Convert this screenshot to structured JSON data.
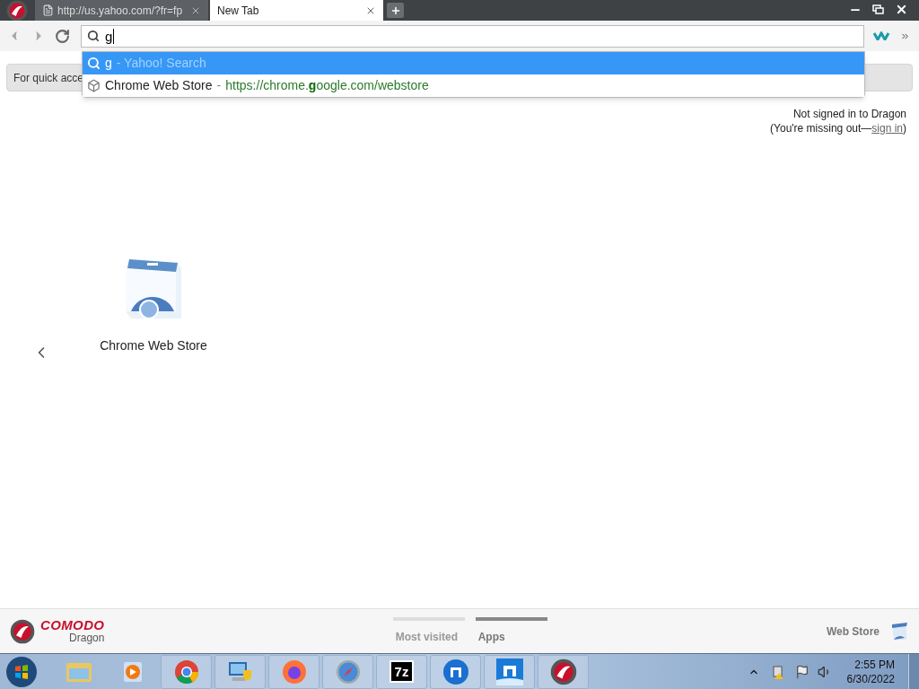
{
  "tabs": [
    {
      "title": "http://us.yahoo.com/?fr=fp",
      "selected": false
    },
    {
      "title": "New Tab",
      "selected": true
    }
  ],
  "omnibox": {
    "value": "g"
  },
  "suggestions": [
    {
      "kind": "search",
      "query": "g",
      "description": "- Yahoo! Search",
      "selected": true
    },
    {
      "kind": "url",
      "title": "Chrome Web Store",
      "separator": "-",
      "url": "https://chrome.**g**oogle.com/webstore",
      "selected": false
    }
  ],
  "bookmark_hint": "For quick acce",
  "signin": {
    "line1": "Not signed in to Dragon",
    "prefix": "(You're missing out—",
    "link": "sign in",
    "suffix": ")"
  },
  "apps": [
    {
      "name": "Chrome Web Store"
    }
  ],
  "footer": {
    "brand": "COMODO",
    "product": "Dragon",
    "tabs": [
      {
        "label": "Most visited",
        "selected": false
      },
      {
        "label": "Apps",
        "selected": true
      }
    ],
    "web_store": "Web Store"
  },
  "taskbar": {
    "items": [
      {
        "kind": "explorer",
        "running": false
      },
      {
        "kind": "media",
        "running": false
      },
      {
        "kind": "chrome",
        "running": true
      },
      {
        "kind": "control",
        "running": true
      },
      {
        "kind": "firefox",
        "running": true
      },
      {
        "kind": "safari",
        "running": true
      },
      {
        "kind": "sevenzip",
        "label": "7z",
        "running": true
      },
      {
        "kind": "maxthon-round",
        "running": true
      },
      {
        "kind": "maxthon",
        "running": true
      },
      {
        "kind": "dragon",
        "running": true
      }
    ],
    "time": "2:55 PM",
    "date": "6/30/2022"
  }
}
